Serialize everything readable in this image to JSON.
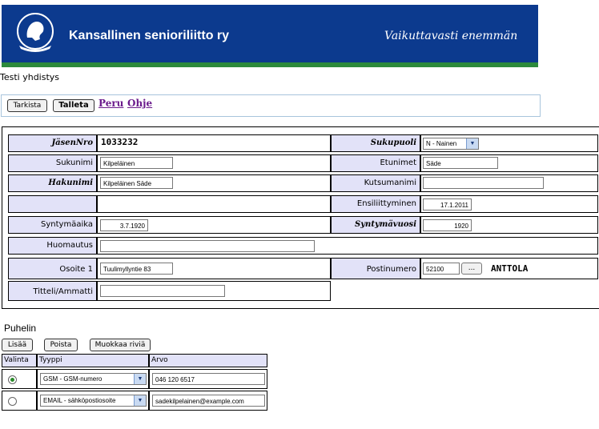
{
  "header": {
    "org_name": "Kansallinen senioriliitto ry",
    "slogan": "Vaikuttavasti enemmän",
    "colors": {
      "banner": "#0c3a8e",
      "stripe": "#2c8a3c"
    }
  },
  "association": "Testi yhdistys",
  "toolbar": {
    "check_label": "Tarkista",
    "save_label": "Talleta",
    "cancel_link": "Peru",
    "help_link": "Ohje"
  },
  "form": {
    "member_no_label": "JäsenNro",
    "member_no": "1033232",
    "gender_label": "Sukupuoli",
    "gender_value": "N - Nainen",
    "lastname_label": "Sukunimi",
    "lastname": "Kilpeläinen",
    "firstnames_label": "Etunimet",
    "firstnames": "Säde",
    "searchname_label": "Hakunimi",
    "searchname": "Kilpeläinen Säde",
    "callname_label": "Kutsumanimi",
    "callname": "",
    "joined_label": "Ensiliittyminen",
    "joined": "17.1.2011",
    "birthdate_label": "Syntymäaika",
    "birthdate": "3.7.1920",
    "birthyear_label": "Syntymävuosi",
    "birthyear": "1920",
    "note_label": "Huomautus",
    "note": "",
    "address_label": "Osoite 1",
    "address": "Tuulimyllyntie 83",
    "postal_label": "Postinumero",
    "postal_code": "52100",
    "postal_button": "...",
    "city": "ANTTOLA",
    "title_label": "Titteli/Ammatti",
    "title": ""
  },
  "phones": {
    "heading": "Puhelin",
    "add_label": "Lisää",
    "delete_label": "Poista",
    "edit_label": "Muokkaa riviä",
    "columns": [
      "Valinta",
      "Tyyppi",
      "Arvo"
    ],
    "rows": [
      {
        "selected": true,
        "type": "GSM - GSM-numero",
        "value": "046 120 6517"
      },
      {
        "selected": false,
        "type": "EMAIL - sähköpostiosoite",
        "value": "sadekilpelainen@example.com"
      }
    ]
  }
}
